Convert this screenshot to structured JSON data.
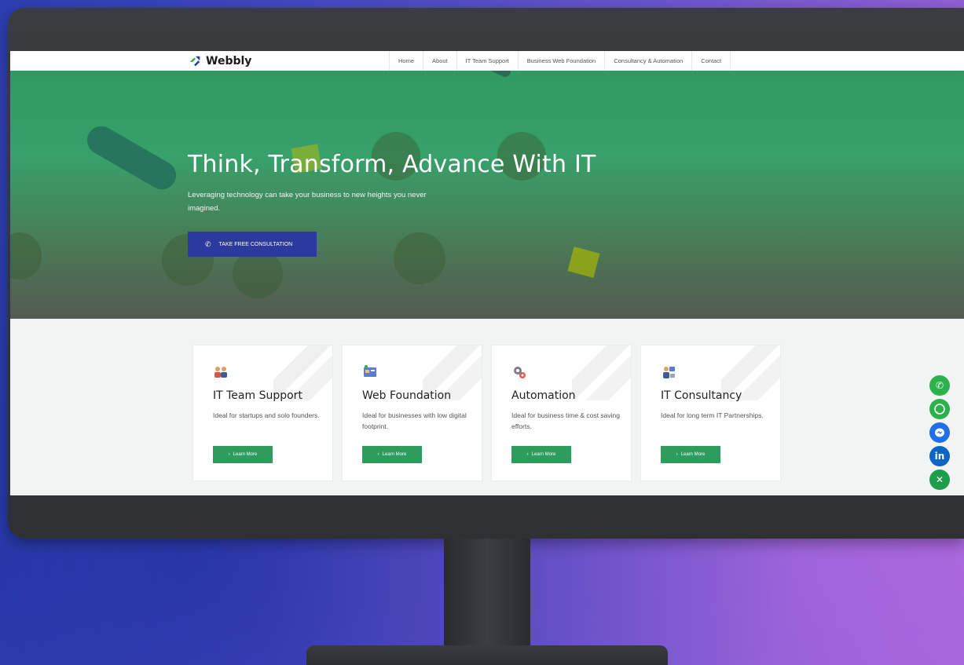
{
  "site": {
    "logo_text": "Webbly"
  },
  "nav": {
    "items": [
      {
        "label": "Home"
      },
      {
        "label": "About"
      },
      {
        "label": "IT Team Support"
      },
      {
        "label": "Business Web Foundation"
      },
      {
        "label": "Consultancy & Automation"
      },
      {
        "label": "Contact"
      }
    ]
  },
  "hero": {
    "title": "Think, Transform, Advance With IT",
    "subtitle": "Leveraging technology can take your business to new heights you never imagined.",
    "cta_label": "TAKE FREE CONSULTATION",
    "cta_icon": "phone-icon"
  },
  "cards": [
    {
      "title": "IT Team Support",
      "description": "Ideal for startups and solo founders.",
      "button": "Learn More",
      "icon": "team-icon"
    },
    {
      "title": "Web Foundation",
      "description": "Ideal for businesses with low digital footprint.",
      "button": "Learn More",
      "icon": "web-icon"
    },
    {
      "title": "Automation",
      "description": "Ideal for business time & cost saving efforts.",
      "button": "Learn More",
      "icon": "gears-icon"
    },
    {
      "title": "IT Consultancy",
      "description": "Ideal for long term IT Partnerships.",
      "button": "Learn More",
      "icon": "consultant-icon"
    }
  ],
  "social": [
    {
      "name": "phone-icon",
      "color": "#2bb24c"
    },
    {
      "name": "whatsapp-icon",
      "color": "#2bb24c"
    },
    {
      "name": "messenger-icon",
      "color": "#1e6fe8"
    },
    {
      "name": "linkedin-icon",
      "color": "#0a66c2",
      "label": "in"
    },
    {
      "name": "close-icon",
      "color": "#1e9e4a"
    }
  ],
  "colors": {
    "hero_green": "#38a06a",
    "cta_blue": "#2c3a9e",
    "card_button_green": "#2e9c5c"
  }
}
